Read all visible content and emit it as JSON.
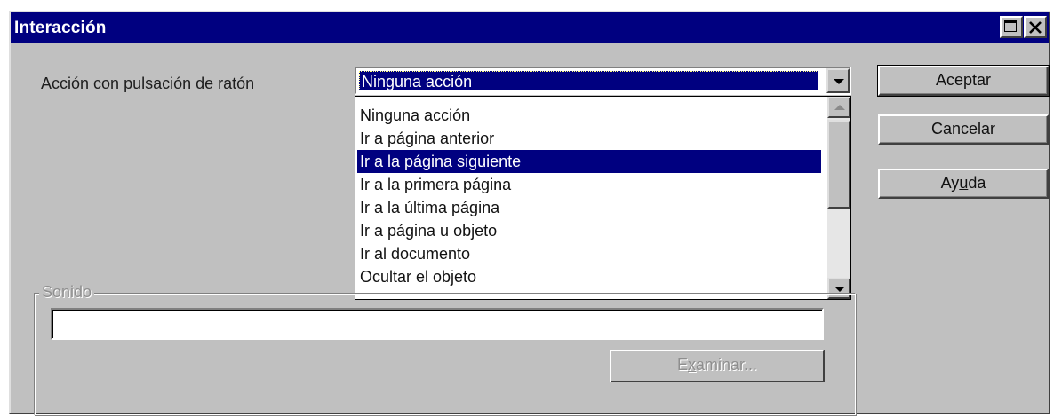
{
  "window": {
    "title": "Interacción"
  },
  "action": {
    "label": "Acción con pulsación de ratón",
    "selected_value": "Ninguna acción",
    "options": [
      "Ninguna acción",
      "Ir a página anterior",
      "Ir a la página siguiente",
      "Ir a la primera página",
      "Ir a la última página",
      "Ir a página u objeto",
      "Ir al documento",
      "Ocultar el objeto"
    ],
    "highlighted_index": 2
  },
  "buttons": {
    "ok": "Aceptar",
    "cancel": "Cancelar",
    "help": "Ayuda"
  },
  "sound": {
    "group_title": "Sonido",
    "value": "",
    "browse_label": "Examinar..."
  },
  "colors": {
    "titlebar": "#000080",
    "face": "#c0c0c0",
    "highlight": "#000080"
  },
  "icons": {
    "maximize": "maximize-icon",
    "close": "close-icon",
    "dropdown": "chevron-down-icon",
    "scroll_up": "scroll-up-icon",
    "scroll_down": "scroll-down-icon"
  }
}
